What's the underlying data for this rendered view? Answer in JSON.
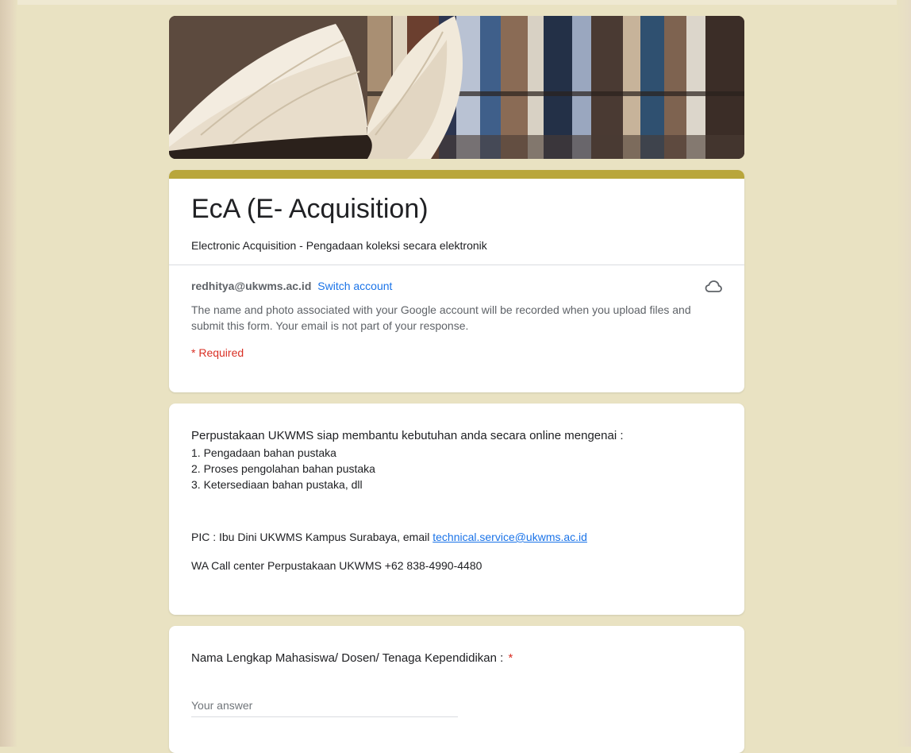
{
  "form": {
    "title": "EcA (E- Acquisition)",
    "description": "Electronic Acquisition - Pengadaan koleksi secara elektronik",
    "accent_color": "#b9a63b",
    "background_color": "#e9e2c2"
  },
  "account": {
    "email": "redhitya@ukwms.ac.id",
    "switch_label": "Switch account",
    "note": "The name and photo associated with your Google account will be recorded when you upload files and submit this form. Your email is not part of your response.",
    "cloud_icon": "cloud-save-icon"
  },
  "required_note": "* Required",
  "info": {
    "lead": "Perpustakaan UKWMS siap membantu kebutuhan anda secara online mengenai :",
    "items": [
      "1. Pengadaan bahan pustaka",
      "2. Proses pengolahan bahan pustaka",
      "3. Ketersediaan bahan pustaka, dll"
    ],
    "pic_prefix": "PIC : Ibu Dini UKWMS Kampus Surabaya, email ",
    "pic_email": "technical.service@ukwms.ac.id",
    "wa_line": "WA Call center Perpustakaan UKWMS +62 838-4990-4480"
  },
  "question": {
    "label": "Nama Lengkap Mahasiswa/ Dosen/ Tenaga Kependidikan :",
    "required_mark": "*",
    "placeholder": "Your answer",
    "value": ""
  }
}
